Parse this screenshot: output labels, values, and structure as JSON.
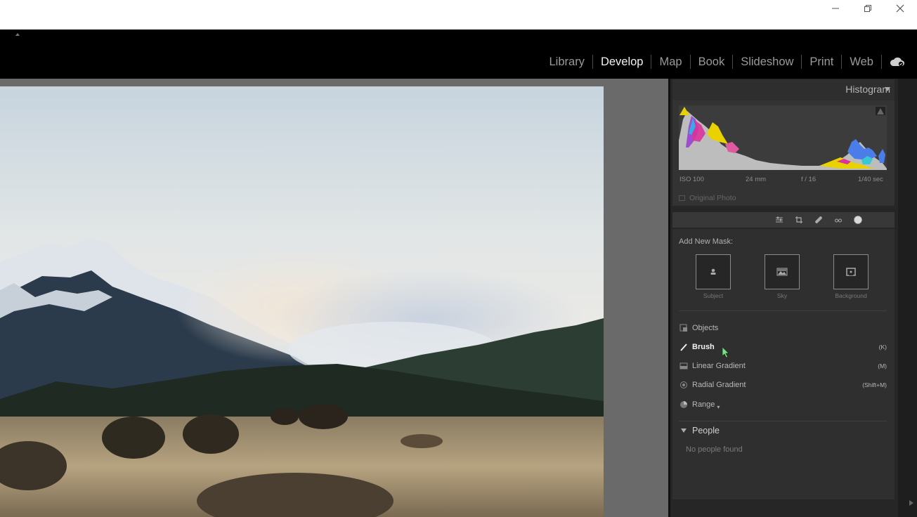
{
  "window": {
    "controls": [
      "minimize",
      "restore",
      "close"
    ]
  },
  "modules": {
    "items": [
      "Library",
      "Develop",
      "Map",
      "Book",
      "Slideshow",
      "Print",
      "Web"
    ],
    "active": "Develop"
  },
  "histogram": {
    "title": "Histogram",
    "iso": "ISO 100",
    "focal": "24 mm",
    "aperture": "f / 16",
    "shutter": "1/40 sec",
    "original_photo": "Original Photo"
  },
  "masking": {
    "add_new_label": "Add New Mask:",
    "quick_masks": [
      {
        "label": "Subject"
      },
      {
        "label": "Sky"
      },
      {
        "label": "Background"
      }
    ],
    "tools": [
      {
        "label": "Objects",
        "key": ""
      },
      {
        "label": "Brush",
        "key": "(K)"
      },
      {
        "label": "Linear Gradient",
        "key": "(M)"
      },
      {
        "label": "Radial Gradient",
        "key": "(Shift+M)"
      },
      {
        "label": "Range",
        "key": ""
      }
    ],
    "people": {
      "title": "People",
      "empty": "No people found"
    }
  },
  "colors": {
    "accent_yellow": "#e8d000",
    "panel_bg": "#2f2f2f",
    "active_module": "#f2f2f2",
    "cursor_green": "#7fe08a"
  }
}
